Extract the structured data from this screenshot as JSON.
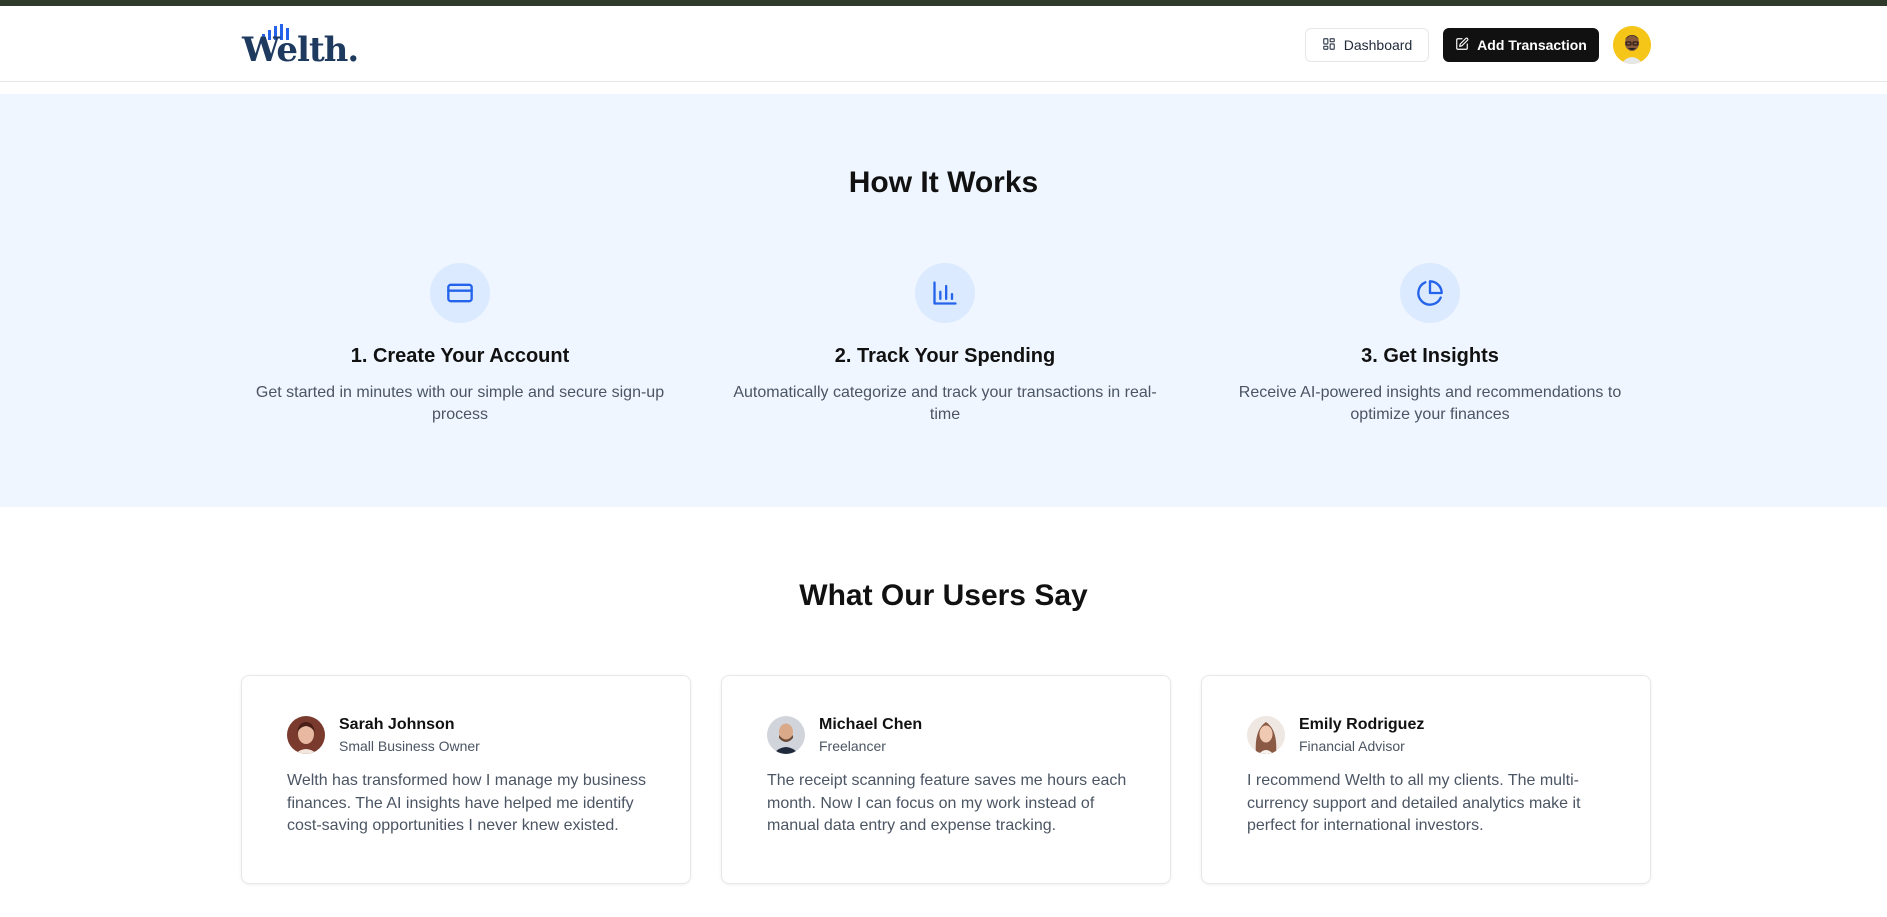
{
  "nav": {
    "logo_text": "Welth.",
    "dashboard_label": "Dashboard",
    "add_transaction_label": "Add Transaction"
  },
  "how_it_works": {
    "title": "How It Works",
    "steps": [
      {
        "icon": "credit-card-icon",
        "title": "1. Create Your Account",
        "description": "Get started in minutes with our simple and secure sign-up process"
      },
      {
        "icon": "bar-chart-icon",
        "title": "2. Track Your Spending",
        "description": "Automatically categorize and track your transactions in real-time"
      },
      {
        "icon": "pie-chart-icon",
        "title": "3. Get Insights",
        "description": "Receive AI-powered insights and recommendations to optimize your finances"
      }
    ]
  },
  "testimonials": {
    "title": "What Our Users Say",
    "items": [
      {
        "name": "Sarah Johnson",
        "role": "Small Business Owner",
        "quote": "Welth has transformed how I manage my business finances. The AI insights have helped me identify cost-saving opportunities I never knew existed."
      },
      {
        "name": "Michael Chen",
        "role": "Freelancer",
        "quote": "The receipt scanning feature saves me hours each month. Now I can focus on my work instead of manual data entry and expense tracking."
      },
      {
        "name": "Emily Rodriguez",
        "role": "Financial Advisor",
        "quote": "I recommend Welth to all my clients. The multi-currency support and detailed analytics make it perfect for international investors."
      }
    ]
  },
  "colors": {
    "accent": "#2563eb",
    "section_bg": "#eff6ff",
    "icon_bg": "#dbeafe",
    "primary_button": "#111111"
  }
}
